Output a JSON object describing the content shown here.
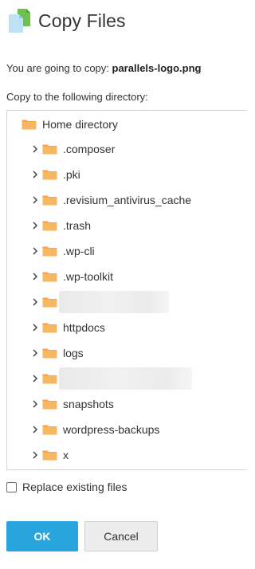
{
  "dialog": {
    "title": "Copy Files",
    "icon": "copy-files-icon"
  },
  "info": {
    "prefix": "You are going to copy: ",
    "filename": "parallels-logo.png"
  },
  "directory_label": "Copy to the following directory:",
  "tree": {
    "root_label": "Home directory",
    "folders": [
      {
        "label": ".composer",
        "redacted": false
      },
      {
        "label": ".pki",
        "redacted": false
      },
      {
        "label": ".revisium_antivirus_cache",
        "redacted": false
      },
      {
        "label": ".trash",
        "redacted": false
      },
      {
        "label": ".wp-cli",
        "redacted": false
      },
      {
        "label": ".wp-toolkit",
        "redacted": false
      },
      {
        "label": "",
        "redacted": true
      },
      {
        "label": "httpdocs",
        "redacted": false
      },
      {
        "label": "logs",
        "redacted": false
      },
      {
        "label": "",
        "redacted": true
      },
      {
        "label": "snapshots",
        "redacted": false
      },
      {
        "label": "wordpress-backups",
        "redacted": false
      },
      {
        "label": "x",
        "redacted": false
      }
    ]
  },
  "replace_option": {
    "label": "Replace existing files",
    "checked": false
  },
  "buttons": {
    "ok": "OK",
    "cancel": "Cancel"
  },
  "colors": {
    "folder": "#f5a548",
    "primary_button": "#28a5dd",
    "secondary_button": "#ececec"
  }
}
